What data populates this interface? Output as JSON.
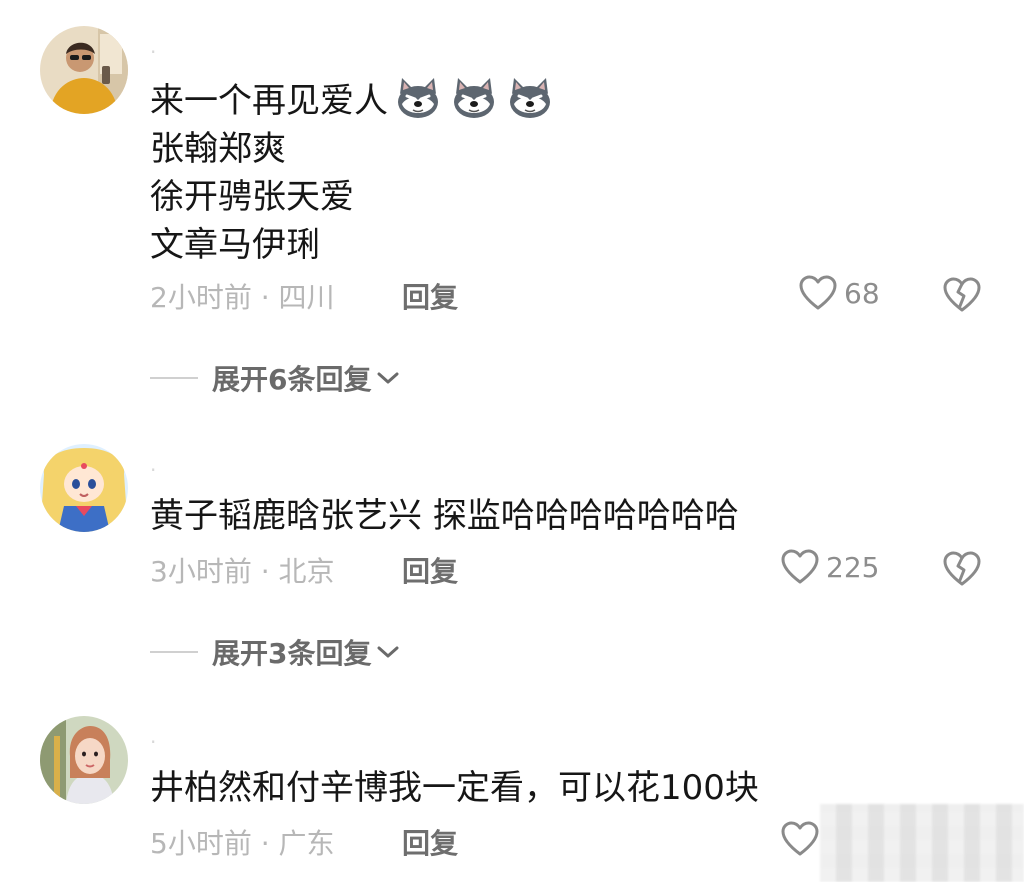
{
  "comments": [
    {
      "lines": [
        "来一个再见爱人",
        "张翰郑爽",
        "徐开骋张天爱",
        "文章马伊琍"
      ],
      "emoji": "wolf-face",
      "time": "2小时前 · 四川",
      "reply_label": "回复",
      "likes": "68",
      "expand_label": "展开6条回复"
    },
    {
      "lines": [
        "黄子韬鹿晗张艺兴 探监哈哈哈哈哈哈哈"
      ],
      "time": "3小时前 · 北京",
      "reply_label": "回复",
      "likes": "225",
      "expand_label": "展开3条回复"
    },
    {
      "lines": [
        "井柏然和付辛博我一定看，可以花100块"
      ],
      "time": "5小时前 · 广东",
      "reply_label": "回复",
      "likes": ""
    }
  ]
}
